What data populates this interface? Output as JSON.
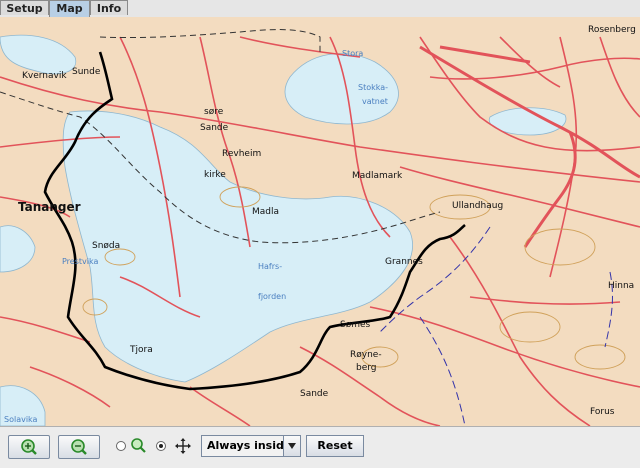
{
  "tabs": [
    {
      "label": "Setup",
      "active": false
    },
    {
      "label": "Map",
      "active": true
    },
    {
      "label": "Info",
      "active": false
    }
  ],
  "map": {
    "labels": {
      "kvernavik": "Kvernavik",
      "sunde": "Sunde",
      "tananger": "Tananger",
      "sore": "søre",
      "sande_top": "Sande",
      "revheim": "Revheim",
      "kirke": "kirke",
      "madla": "Madla",
      "madlamark": "Madlamark",
      "ullandhaug": "Ullandhaug",
      "snoda": "Snøda",
      "grannes": "Grannes",
      "somes": "Sømes",
      "royneberg1": "Røyne-",
      "royneberg2": "berg",
      "tjora": "Tjora",
      "sande_bottom": "Sande",
      "forus": "Forus",
      "rosenberg": "Rosenberg",
      "hinna": "Hinna",
      "stora": "Stora",
      "stokka1": "Stokka-",
      "stokka2": "vatnet",
      "hafrs1": "Hafrs-",
      "hafrs2": "fjorden",
      "prestvika": "Prestvika",
      "solavika": "Solavika"
    }
  },
  "toolbar": {
    "zoom_in_icon": "zoom-in-icon",
    "zoom_out_icon": "zoom-out-icon",
    "mode_select": "Always inside",
    "reset_label": "Reset"
  },
  "colors": {
    "land": "#f3dcc0",
    "water": "#d7eef7",
    "road": "#e2535a",
    "route": "#000000",
    "tab_active": "#b8cfe5"
  }
}
